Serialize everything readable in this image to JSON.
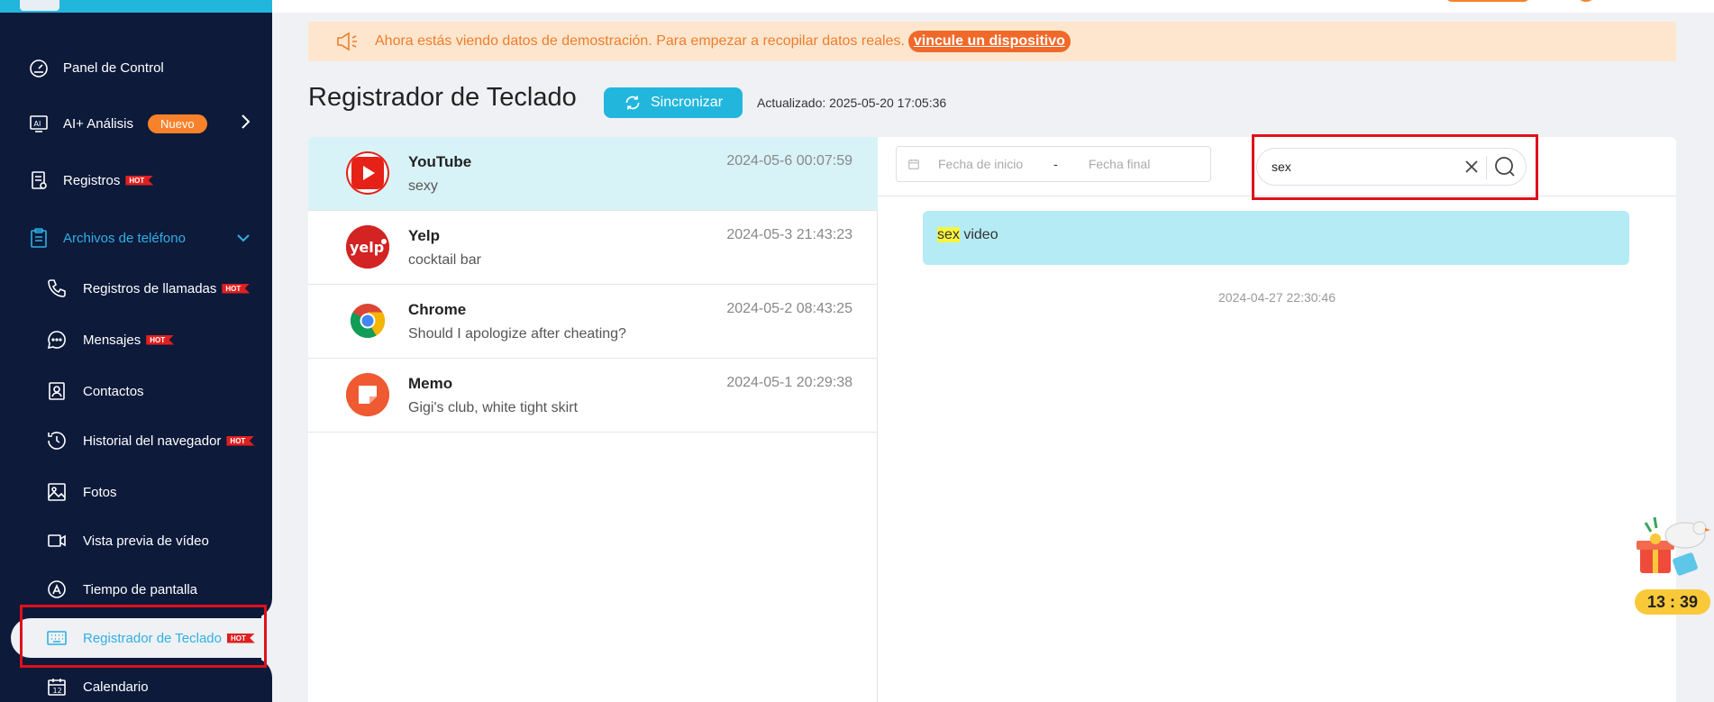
{
  "sidebar": {
    "items": [
      {
        "label": "Panel de Control"
      },
      {
        "label": "AI+ Análisis",
        "badge": "Nuevo"
      },
      {
        "label": "Registros",
        "hot": "HOT"
      },
      {
        "label": "Archivos de teléfono"
      },
      {
        "label": "Registros de llamadas",
        "hot": "HOT"
      },
      {
        "label": "Mensajes",
        "hot": "HOT"
      },
      {
        "label": "Contactos"
      },
      {
        "label": "Historial del navegador",
        "hot": "HOT"
      },
      {
        "label": "Fotos"
      },
      {
        "label": "Vista previa de vídeo"
      },
      {
        "label": "Tiempo de pantalla"
      },
      {
        "label": "Registrador de Teclado",
        "hot": "HOT"
      },
      {
        "label": "Calendario"
      }
    ]
  },
  "banner": {
    "text": "Ahora estás viendo datos de demostración. Para empezar a recopilar datos reales.",
    "link": "vincule un dispositivo"
  },
  "header": {
    "title": "Registrador de Teclado",
    "sync_label": "Sincronizar",
    "updated": "Actualizado: 2025-05-20 17:05:36"
  },
  "list": [
    {
      "app": "YouTube",
      "text": "sexy",
      "time": "2024-05-6 00:07:59"
    },
    {
      "app": "Yelp",
      "text": "cocktail bar",
      "time": "2024-05-3 21:43:23"
    },
    {
      "app": "Chrome",
      "text": "Should I apologize after cheating?",
      "time": "2024-05-2 08:43:25"
    },
    {
      "app": "Memo",
      "text": "Gigi's club, white tight skirt",
      "time": "2024-05-1 20:29:38"
    }
  ],
  "filter": {
    "start_placeholder": "Fecha de inicio",
    "separator": "-",
    "end_placeholder": "Fecha final",
    "search_value": "sex"
  },
  "message": {
    "highlight": "sex",
    "rest": " video",
    "time": "2024-04-27 22:30:46"
  },
  "widget": {
    "timer": "13 : 39"
  },
  "colors": {
    "sidebar_bg": "#0d1a3a",
    "accent": "#22b6dd",
    "orange": "#f7822a",
    "hot_red": "#e02020",
    "selected_row": "#d8f3f8",
    "bubble": "#b4ebf5",
    "highlight_yellow": "#f7f43e",
    "annotation_red": "#e0101a"
  },
  "icons": {
    "youtube": "youtube-icon",
    "yelp": "yelp-icon",
    "chrome": "chrome-icon",
    "memo": "memo-icon"
  }
}
